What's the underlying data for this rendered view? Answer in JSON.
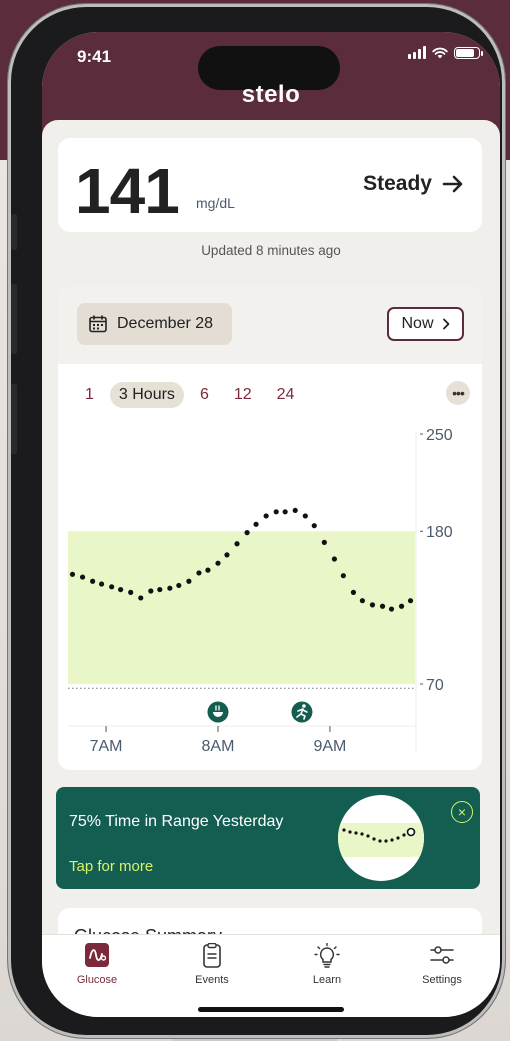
{
  "status_bar": {
    "time": "9:41"
  },
  "app": {
    "brand": "stelo"
  },
  "glucose": {
    "value": "141",
    "unit": "mg/dL",
    "trend": "Steady",
    "updated": "Updated 8 minutes ago"
  },
  "date_selector": {
    "date": "December 28",
    "now_label": "Now"
  },
  "time_ranges": {
    "items": [
      "1",
      "3 Hours",
      "6",
      "12",
      "24"
    ],
    "selected": "3 Hours"
  },
  "chart_data": {
    "type": "scatter",
    "y_ticks": [
      "250",
      "180",
      "70"
    ],
    "x_ticks": [
      "7AM",
      "8AM",
      "9AM"
    ],
    "target_range": [
      70,
      180
    ],
    "ylim": [
      65,
      250
    ],
    "xlim": [
      6.66,
      9.76
    ],
    "events": [
      {
        "time": 8.0,
        "icon": "meal-icon"
      },
      {
        "time": 8.75,
        "icon": "exercise-icon"
      }
    ],
    "series": [
      {
        "values": [
          [
            6.7,
            149
          ],
          [
            6.79,
            147
          ],
          [
            6.88,
            144
          ],
          [
            6.96,
            142
          ],
          [
            7.05,
            140
          ],
          [
            7.13,
            138
          ],
          [
            7.22,
            136
          ],
          [
            7.31,
            132
          ],
          [
            7.4,
            137
          ],
          [
            7.48,
            138
          ],
          [
            7.57,
            139
          ],
          [
            7.65,
            141
          ],
          [
            7.74,
            144
          ],
          [
            7.83,
            150
          ],
          [
            7.91,
            152
          ],
          [
            8.0,
            157
          ],
          [
            8.08,
            163
          ],
          [
            8.17,
            171
          ],
          [
            8.26,
            179
          ],
          [
            8.34,
            185
          ],
          [
            8.43,
            191
          ],
          [
            8.52,
            194
          ],
          [
            8.6,
            194
          ],
          [
            8.69,
            195
          ],
          [
            8.78,
            191
          ],
          [
            8.86,
            184
          ],
          [
            8.95,
            172
          ],
          [
            9.04,
            160
          ],
          [
            9.12,
            148
          ],
          [
            9.21,
            136
          ],
          [
            9.29,
            130
          ],
          [
            9.38,
            127
          ],
          [
            9.47,
            126
          ],
          [
            9.55,
            124
          ],
          [
            9.64,
            126
          ],
          [
            9.72,
            130
          ]
        ]
      }
    ],
    "colors": {
      "in_range": "#e9f6c7",
      "dots": "#111111",
      "event_badge": "#145e51"
    }
  },
  "tir_card": {
    "title": "75% Time in Range Yesterday",
    "link": "Tap for more"
  },
  "summary": {
    "title": "Glucose Summary"
  },
  "tabbar": {
    "items": [
      "Glucose",
      "Events",
      "Learn",
      "Settings"
    ],
    "active": "Glucose"
  },
  "colors": {
    "brand": "#5a2c3c",
    "accent_teal": "#145e51",
    "accent_lime": "#d7f36b"
  }
}
